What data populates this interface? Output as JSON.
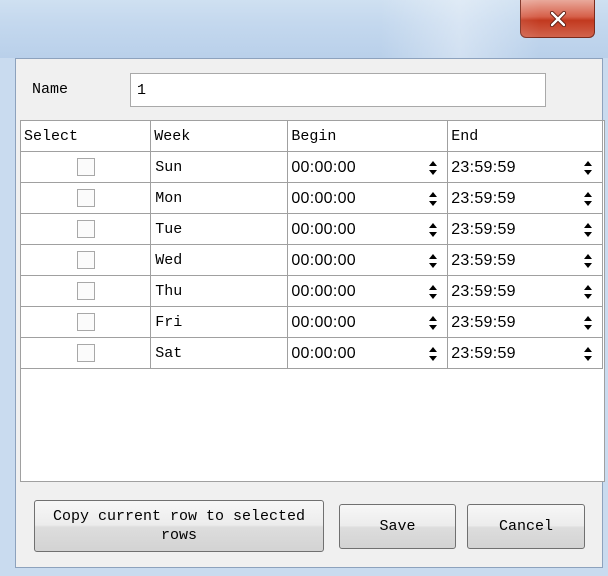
{
  "window": {
    "close_icon": "close-icon",
    "accent_close": "#c2391f"
  },
  "form": {
    "name_label": "Name",
    "name_value": "1"
  },
  "table": {
    "headers": [
      "Select",
      "Week",
      "Begin",
      "End"
    ],
    "rows": [
      {
        "checked": false,
        "day": "Sun",
        "begin": "00:00:00",
        "end": "23:59:59"
      },
      {
        "checked": false,
        "day": "Mon",
        "begin": "00:00:00",
        "end": "23:59:59"
      },
      {
        "checked": false,
        "day": "Tue",
        "begin": "00:00:00",
        "end": "23:59:59"
      },
      {
        "checked": false,
        "day": "Wed",
        "begin": "00:00:00",
        "end": "23:59:59"
      },
      {
        "checked": false,
        "day": "Thu",
        "begin": "00:00:00",
        "end": "23:59:59"
      },
      {
        "checked": false,
        "day": "Fri",
        "begin": "00:00:00",
        "end": "23:59:59"
      },
      {
        "checked": false,
        "day": "Sat",
        "begin": "00:00:00",
        "end": "23:59:59"
      }
    ]
  },
  "buttons": {
    "copy_label": "Copy current row to selected rows",
    "save_label": "Save",
    "cancel_label": "Cancel"
  }
}
